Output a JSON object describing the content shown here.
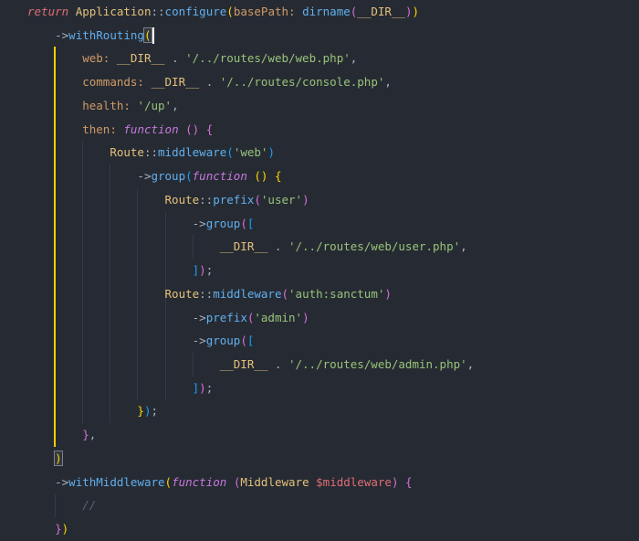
{
  "editor": {
    "language_hint": "php",
    "colors": {
      "background": "#262b33",
      "default_text": "#abb2bf",
      "keyword_red": "#e06c75",
      "keyword_purple": "#c678dd",
      "class_yellow": "#e5c07b",
      "function_blue": "#61afef",
      "named_arg_orange": "#d19a66",
      "string_green": "#98c379",
      "comment_gray": "#5c6370",
      "bracket_gold": "#ffd700",
      "bracket_orchid": "#d670d6",
      "bracket_blue": "#1a9fff",
      "caret": "#ffffff",
      "active_guide": "#ffd700",
      "faint_guide": "#343a46"
    },
    "cursor": {
      "line": 2
    },
    "guides": [
      {
        "col": 4,
        "from": 3,
        "to": 19,
        "kind": "active"
      },
      {
        "col": 8,
        "from": 7,
        "to": 18,
        "kind": "faint"
      },
      {
        "col": 12,
        "from": 8,
        "to": 18,
        "kind": "faint"
      },
      {
        "col": 16,
        "from": 9,
        "to": 17,
        "kind": "faint"
      },
      {
        "col": 20,
        "from": 10,
        "to": 17,
        "kind": "faint"
      },
      {
        "col": 24,
        "from": 11,
        "to": 11,
        "kind": "faint"
      },
      {
        "col": 24,
        "from": 16,
        "to": 16,
        "kind": "faint"
      },
      {
        "col": 4,
        "from": 22,
        "to": 22,
        "kind": "faint"
      }
    ],
    "lines": [
      {
        "tokens": [
          [
            "r",
            "return"
          ],
          [
            "p",
            " "
          ],
          [
            "c",
            "Application"
          ],
          [
            "p",
            "::"
          ],
          [
            "f",
            "configure"
          ],
          [
            "g",
            "("
          ],
          [
            "a",
            "basePath:"
          ],
          [
            "p",
            " "
          ],
          [
            "f",
            "dirname"
          ],
          [
            "o",
            "("
          ],
          [
            "d",
            "__DIR__"
          ],
          [
            "o",
            ")"
          ],
          [
            "g",
            ")"
          ]
        ]
      },
      {
        "tokens": [
          [
            "p",
            "    "
          ],
          [
            "p",
            "->"
          ],
          [
            "f",
            "withRouting"
          ],
          [
            "gx",
            "("
          ]
        ]
      },
      {
        "tokens": [
          [
            "p",
            "        "
          ],
          [
            "a",
            "web:"
          ],
          [
            "p",
            " "
          ],
          [
            "d",
            "__DIR__"
          ],
          [
            "p",
            " . "
          ],
          [
            "s",
            "'/../routes/web/web.php'"
          ],
          [
            "p",
            ","
          ]
        ]
      },
      {
        "tokens": [
          [
            "p",
            "        "
          ],
          [
            "a",
            "commands:"
          ],
          [
            "p",
            " "
          ],
          [
            "d",
            "__DIR__"
          ],
          [
            "p",
            " . "
          ],
          [
            "s",
            "'/../routes/console.php'"
          ],
          [
            "p",
            ","
          ]
        ]
      },
      {
        "tokens": [
          [
            "p",
            "        "
          ],
          [
            "a",
            "health:"
          ],
          [
            "p",
            " "
          ],
          [
            "s",
            "'/up'"
          ],
          [
            "p",
            ","
          ]
        ]
      },
      {
        "tokens": [
          [
            "p",
            "        "
          ],
          [
            "a",
            "then:"
          ],
          [
            "p",
            " "
          ],
          [
            "k",
            "function"
          ],
          [
            "p",
            " "
          ],
          [
            "o",
            "()"
          ],
          [
            "p",
            " "
          ],
          [
            "o",
            "{"
          ]
        ]
      },
      {
        "tokens": [
          [
            "p",
            "            "
          ],
          [
            "c",
            "Route"
          ],
          [
            "p",
            "::"
          ],
          [
            "f",
            "middleware"
          ],
          [
            "u",
            "("
          ],
          [
            "s",
            "'web'"
          ],
          [
            "u",
            ")"
          ]
        ]
      },
      {
        "tokens": [
          [
            "p",
            "                "
          ],
          [
            "p",
            "->"
          ],
          [
            "f",
            "group"
          ],
          [
            "u",
            "("
          ],
          [
            "k",
            "function"
          ],
          [
            "p",
            " "
          ],
          [
            "g",
            "()"
          ],
          [
            "p",
            " "
          ],
          [
            "g",
            "{"
          ]
        ]
      },
      {
        "tokens": [
          [
            "p",
            "                    "
          ],
          [
            "c",
            "Route"
          ],
          [
            "p",
            "::"
          ],
          [
            "f",
            "prefix"
          ],
          [
            "o",
            "("
          ],
          [
            "s",
            "'user'"
          ],
          [
            "o",
            ")"
          ]
        ]
      },
      {
        "tokens": [
          [
            "p",
            "                        "
          ],
          [
            "p",
            "->"
          ],
          [
            "f",
            "group"
          ],
          [
            "o",
            "("
          ],
          [
            "u",
            "["
          ]
        ]
      },
      {
        "tokens": [
          [
            "p",
            "                            "
          ],
          [
            "d",
            "__DIR__"
          ],
          [
            "p",
            " . "
          ],
          [
            "s",
            "'/../routes/web/user.php'"
          ],
          [
            "p",
            ","
          ]
        ]
      },
      {
        "tokens": [
          [
            "p",
            "                        "
          ],
          [
            "u",
            "]"
          ],
          [
            "o",
            ")"
          ],
          [
            "p",
            ";"
          ]
        ]
      },
      {
        "tokens": [
          [
            "p",
            "                    "
          ],
          [
            "c",
            "Route"
          ],
          [
            "p",
            "::"
          ],
          [
            "f",
            "middleware"
          ],
          [
            "o",
            "("
          ],
          [
            "s",
            "'auth:sanctum'"
          ],
          [
            "o",
            ")"
          ]
        ]
      },
      {
        "tokens": [
          [
            "p",
            "                        "
          ],
          [
            "p",
            "->"
          ],
          [
            "f",
            "prefix"
          ],
          [
            "o",
            "("
          ],
          [
            "s",
            "'admin'"
          ],
          [
            "o",
            ")"
          ]
        ]
      },
      {
        "tokens": [
          [
            "p",
            "                        "
          ],
          [
            "p",
            "->"
          ],
          [
            "f",
            "group"
          ],
          [
            "o",
            "("
          ],
          [
            "u",
            "["
          ]
        ]
      },
      {
        "tokens": [
          [
            "p",
            "                            "
          ],
          [
            "d",
            "__DIR__"
          ],
          [
            "p",
            " . "
          ],
          [
            "s",
            "'/../routes/web/admin.php'"
          ],
          [
            "p",
            ","
          ]
        ]
      },
      {
        "tokens": [
          [
            "p",
            "                        "
          ],
          [
            "u",
            "]"
          ],
          [
            "o",
            ")"
          ],
          [
            "p",
            ";"
          ]
        ]
      },
      {
        "tokens": [
          [
            "p",
            "                "
          ],
          [
            "g",
            "}"
          ],
          [
            "u",
            ")"
          ],
          [
            "p",
            ";"
          ]
        ]
      },
      {
        "tokens": [
          [
            "p",
            "        "
          ],
          [
            "o",
            "}"
          ],
          [
            "p",
            ","
          ]
        ]
      },
      {
        "tokens": [
          [
            "p",
            "    "
          ],
          [
            "gx",
            ")"
          ]
        ]
      },
      {
        "tokens": [
          [
            "p",
            "    "
          ],
          [
            "p",
            "->"
          ],
          [
            "f",
            "withMiddleware"
          ],
          [
            "g",
            "("
          ],
          [
            "k",
            "function"
          ],
          [
            "p",
            " "
          ],
          [
            "o",
            "("
          ],
          [
            "c",
            "Middleware"
          ],
          [
            "p",
            " "
          ],
          [
            "v",
            "$middleware"
          ],
          [
            "o",
            ")"
          ],
          [
            "p",
            " "
          ],
          [
            "o",
            "{"
          ]
        ]
      },
      {
        "tokens": [
          [
            "p",
            "        "
          ],
          [
            "m",
            "//"
          ]
        ]
      },
      {
        "tokens": [
          [
            "p",
            "    "
          ],
          [
            "o",
            "}"
          ],
          [
            "g",
            ")"
          ]
        ]
      }
    ]
  }
}
